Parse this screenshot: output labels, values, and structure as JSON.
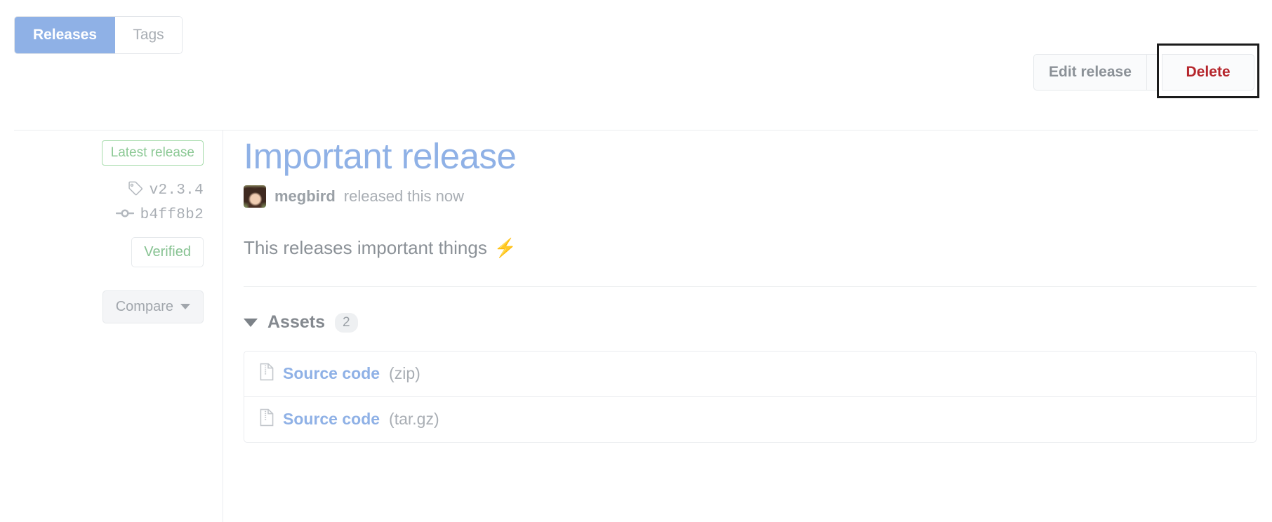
{
  "tabs": [
    {
      "label": "Releases",
      "active": true
    },
    {
      "label": "Tags",
      "active": false
    }
  ],
  "actions": {
    "edit_label": "Edit release",
    "delete_label": "Delete",
    "delete_color": "#b5262c",
    "focused": "delete-button"
  },
  "sidebar": {
    "latest_badge": "Latest release",
    "latest_badge_color": "#8cc995",
    "tag": {
      "icon": "tag-icon",
      "value": "v2.3.4"
    },
    "commit": {
      "icon": "git-commit-icon",
      "value": "b4ff8b2"
    },
    "verified_label": "Verified",
    "verified_color": "#86c291",
    "compare_label": "Compare"
  },
  "release": {
    "title": "Important release",
    "title_color": "#8fb1e6",
    "author": "megbird",
    "published_text": "released this now",
    "description": "This releases important things",
    "description_emoji": "⚡"
  },
  "assets": {
    "heading": "Assets",
    "count": "2",
    "items": [
      {
        "icon": "file-zip-icon",
        "name": "Source code",
        "ext": "(zip)"
      },
      {
        "icon": "file-zip-icon",
        "name": "Source code",
        "ext": "(tar.gz)"
      }
    ]
  }
}
